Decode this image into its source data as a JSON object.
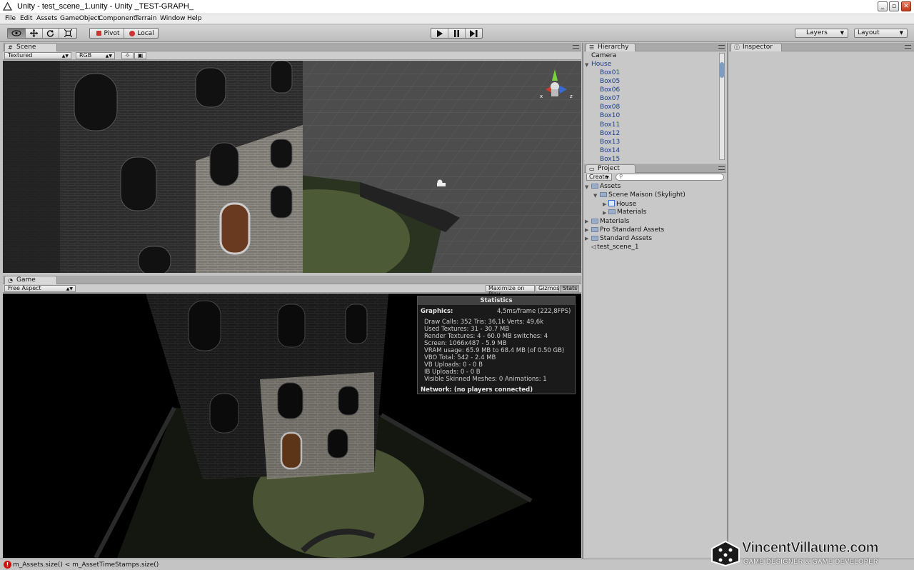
{
  "window": {
    "title": "Unity - test_scene_1.unity - Unity _TEST-GRAPH_"
  },
  "menu": [
    "File",
    "Edit",
    "Assets",
    "GameObject",
    "Component",
    "Terrain",
    "Window",
    "Help"
  ],
  "toolbar": {
    "tools": [
      "hand-tool",
      "move-tool",
      "rotate-tool",
      "scale-tool"
    ],
    "pivot_label": "Pivot",
    "local_label": "Local",
    "layers_label": "Layers",
    "layout_label": "Layout"
  },
  "scene": {
    "tab_label": "Scene",
    "render_mode": "Textured",
    "color_mode": "RGB",
    "gizmo_axes": {
      "x": "x",
      "z": "z"
    }
  },
  "game": {
    "tab_label": "Game",
    "aspect": "Free Aspect",
    "maximize_label": "Maximize on Play",
    "gizmos_label": "Gizmos",
    "stats_label": "Stats"
  },
  "stats": {
    "header": "Statistics",
    "graphics_label": "Graphics:",
    "graphics_value": "4,5ms/frame (222,8FPS)",
    "lines": [
      "Draw Calls: 352   Tris: 36,1k   Verts: 49,6k",
      "Used Textures: 31 - 30.7 MB",
      "Render Textures: 4 - 60.0 MB      switches: 4",
      "Screen: 1066x487 - 5.9 MB",
      "VRAM usage: 65.9 MB to 68.4 MB (of 0.50 GB)",
      "VBO Total: 542 - 2.4 MB",
      "VB Uploads: 0 - 0 B",
      "IB Uploads: 0 - 0 B",
      "Visible Skinned Meshes: 0          Animations: 1"
    ],
    "network": "Network: (no players connected)"
  },
  "hierarchy": {
    "tab_label": "Hierarchy",
    "camera": "Camera",
    "house": "House",
    "children": [
      "Box01",
      "Box05",
      "Box06",
      "Box07",
      "Box08",
      "Box10",
      "Box11",
      "Box12",
      "Box13",
      "Box14",
      "Box15"
    ]
  },
  "project": {
    "tab_label": "Project",
    "create_label": "Create",
    "assets": "Assets",
    "scene_maison": "Scene Maison (Skylight)",
    "house": "House",
    "materials_sub": "Materials",
    "materials": "Materials",
    "pro_std": "Pro Standard Assets",
    "std": "Standard Assets",
    "scene_file": "test_scene_1"
  },
  "inspector": {
    "tab_label": "Inspector"
  },
  "status": {
    "error": "m_Assets.size() < m_AssetTimeStamps.size()"
  },
  "watermark": {
    "main": "VincentVillaume.com",
    "sub": "GAME DESIGNER & GAME DEVELOPER"
  },
  "colors": {
    "link_blue": "#1a3e8f",
    "error_red": "#d01010",
    "grass": "#3d4a2c"
  }
}
